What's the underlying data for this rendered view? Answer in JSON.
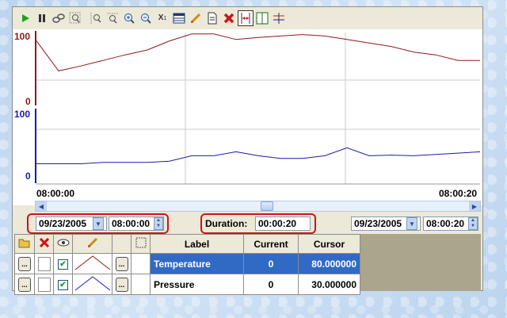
{
  "toolbar": {
    "buttons": [
      "play-icon",
      "pause-icon",
      "link-icon",
      "zoom-region-icon",
      "zoom-region-icon",
      "zoom-y-icon",
      "zoom-in-icon",
      "zoom-out-icon",
      "axis-scale-icon",
      "table-icon",
      "pen-icon",
      "document-icon",
      "delete-icon",
      "range-cursor-icon",
      "cursor-icon",
      "stack-icon"
    ],
    "axis_label": "X",
    "axis_sub": "1"
  },
  "chart": {
    "temp_axis": {
      "top": "100",
      "bottom": "0",
      "color": "#8b1a1a"
    },
    "pres_axis": {
      "top": "100",
      "bottom": "0",
      "color": "#1a1aaa"
    },
    "x_start": "08:00:00",
    "x_end": "08:00:20"
  },
  "chart_data": {
    "type": "line",
    "x": [
      0,
      1,
      2,
      3,
      4,
      5,
      6,
      7,
      8,
      9,
      10,
      11,
      12,
      13,
      14,
      15,
      16,
      17,
      18,
      19,
      20
    ],
    "series": [
      {
        "name": "Temperature",
        "color": "#8b1a1a",
        "ylim": [
          0,
          100
        ],
        "values": [
          88,
          45,
          52,
          60,
          68,
          75,
          88,
          98,
          98,
          90,
          93,
          95,
          97,
          95,
          90,
          85,
          80,
          72,
          68,
          60,
          60
        ]
      },
      {
        "name": "Pressure",
        "color": "#1a1aaa",
        "ylim": [
          0,
          100
        ],
        "values": [
          22,
          22,
          22,
          24,
          24,
          24,
          26,
          34,
          34,
          40,
          34,
          30,
          30,
          34,
          46,
          34,
          35,
          34,
          36,
          38,
          40
        ]
      }
    ]
  },
  "range": {
    "start_date": "09/23/2005",
    "start_time": "08:00:00",
    "duration_label": "Duration:",
    "duration": "00:00:20",
    "end_date": "09/23/2005",
    "end_time": "08:00:20"
  },
  "table": {
    "headers": {
      "label": "Label",
      "current": "Current",
      "cursor": "Cursor"
    },
    "rows": [
      {
        "label": "Temperature",
        "current": "0",
        "cursor": "80.000000",
        "color": "#8b1a1a"
      },
      {
        "label": "Pressure",
        "current": "0",
        "cursor": "30.000000",
        "color": "#1a1aaa"
      }
    ],
    "ellipsis": "..."
  }
}
